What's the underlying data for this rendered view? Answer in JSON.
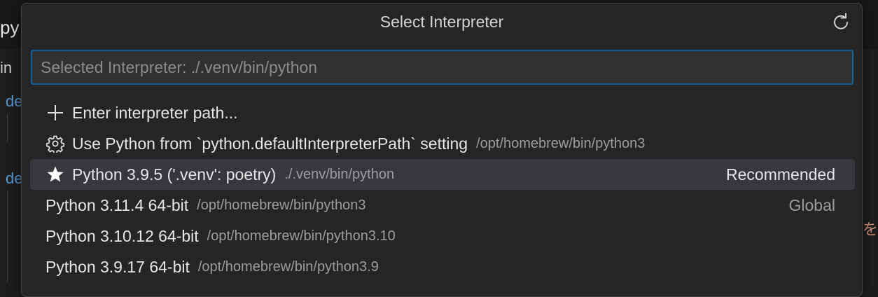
{
  "background": {
    "tab_fragment": "py",
    "line_fragment_1": "in",
    "keyword_1": "de",
    "keyword_2": "de",
    "jp_fragment": "を"
  },
  "quick_pick": {
    "title": "Select Interpreter",
    "refresh_icon": "refresh-icon",
    "input": {
      "value": "",
      "placeholder": "Selected Interpreter: ./.venv/bin/python"
    },
    "items": [
      {
        "icon": "plus-icon",
        "label": "Enter interpreter path...",
        "description": "",
        "detail": ""
      },
      {
        "icon": "gear-icon",
        "label": "Use Python from `python.defaultInterpreterPath` setting",
        "description": "/opt/homebrew/bin/python3",
        "detail": ""
      },
      {
        "icon": "star-icon",
        "label": "Python 3.9.5 ('.venv': poetry)",
        "description": "./.venv/bin/python",
        "detail": "Recommended"
      },
      {
        "icon": "",
        "label": "Python 3.11.4 64-bit",
        "description": "/opt/homebrew/bin/python3",
        "detail": "Global"
      },
      {
        "icon": "",
        "label": "Python 3.10.12 64-bit",
        "description": "/opt/homebrew/bin/python3.10",
        "detail": ""
      },
      {
        "icon": "",
        "label": "Python 3.9.17 64-bit",
        "description": "/opt/homebrew/bin/python3.9",
        "detail": ""
      }
    ],
    "colors": {
      "focus_border": "#0e639c",
      "selected_row": "#37373d",
      "panel": "#252526"
    }
  }
}
